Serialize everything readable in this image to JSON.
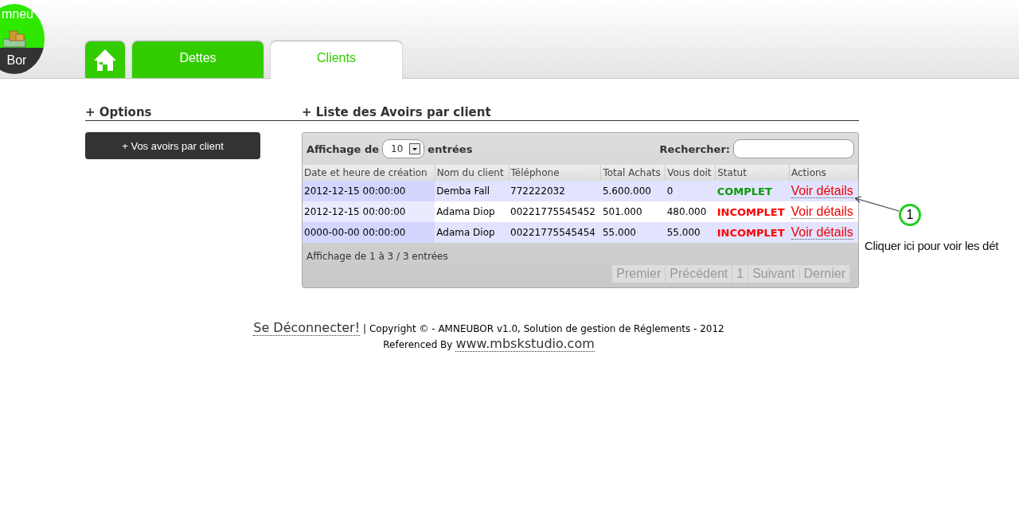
{
  "logo": {
    "top": "mneu",
    "bottom": "Bor"
  },
  "tabs": [
    {
      "kind": "home",
      "selected": false
    },
    {
      "kind": "text",
      "label": "Dettes",
      "selected": false
    },
    {
      "kind": "text",
      "label": "Clients",
      "selected": true
    }
  ],
  "options": {
    "title": "+ Options",
    "button": "+ Vos avoirs par client"
  },
  "list": {
    "title": "+ Liste des Avoirs par client",
    "length_before": "Affichage de",
    "length_value": "10",
    "length_after": "entrées",
    "search_label": "Rechercher:",
    "columns": [
      "Date et heure de création",
      "Nom du client",
      "Téléphone",
      "Total Achats",
      "Vous doit",
      "Statut",
      "Actions"
    ],
    "rows": [
      {
        "cells": [
          "2012-12-15 00:00:00",
          "Demba Fall",
          "772222032",
          "5.600.000",
          "0"
        ],
        "status": "COMPLET",
        "kind": "complete",
        "action": "Voir détails"
      },
      {
        "cells": [
          "2012-12-15 00:00:00",
          "Adama Diop",
          "00221775545452",
          "501.000",
          "480.000"
        ],
        "status": "INCOMPLET",
        "kind": "incomplete",
        "action": "Voir détails"
      },
      {
        "cells": [
          "0000-00-00 00:00:00",
          "Adama Diop",
          "00221775545454",
          "55.000",
          "55.000"
        ],
        "status": "INCOMPLET",
        "kind": "incomplete",
        "action": "Voir détails"
      }
    ],
    "info": "Affichage de 1 à 3 / 3 entrées",
    "pagination": [
      "Premier",
      "Précédent",
      "1",
      "Suivant",
      "Dernier"
    ]
  },
  "callout": {
    "number": "1",
    "text": "Cliquer ici pour voir les dét"
  },
  "footer": {
    "logout": "Se Déconnecter!",
    "copyright": "| Copyright © - AMNEUBOR v1.0, Solution de gestion de Réglements - 2012",
    "referenced": "Referenced By",
    "website": "www.mbskstudio.com"
  }
}
